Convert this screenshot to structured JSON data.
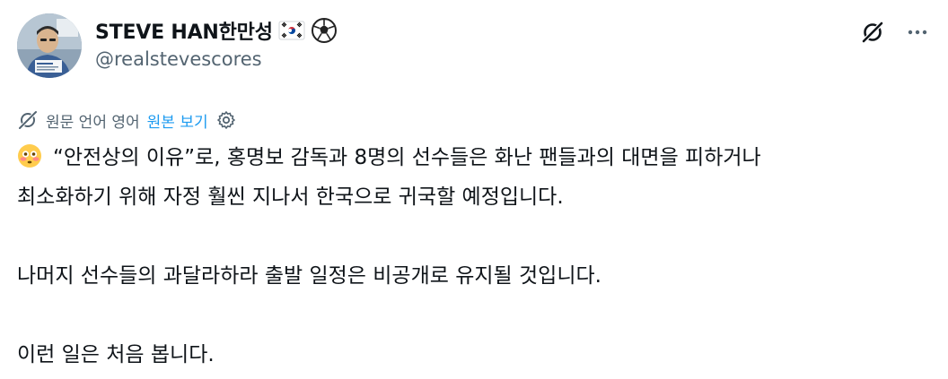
{
  "author": {
    "display_name": "STEVE HAN한만성",
    "handle": "@realstevescores",
    "name_emojis": [
      "flag-south-korea-icon",
      "soccer-ball-icon"
    ]
  },
  "translation": {
    "label": "원문 언어 영어",
    "show_original": "원본 보기"
  },
  "tweet": {
    "paragraph1_line1": "“안전상의 이유”로, 홍명보 감독과 8명의 선수들은 화난 팬들과의 대면을 피하거나",
    "paragraph1_line2": "최소화하기 위해 자정 훨씬 지나서 한국으로 귀국할 예정입니다.",
    "paragraph2": "나머지 선수들의 과달라하라 출발 일정은 비공개로 유지될 것입니다.",
    "paragraph3": "이런 일은 처음 봅니다.",
    "leading_emoji": "flushed-face-icon"
  },
  "colors": {
    "text": "#0f1419",
    "secondary": "#536471",
    "link": "#1d9bf0",
    "background": "#ffffff"
  }
}
